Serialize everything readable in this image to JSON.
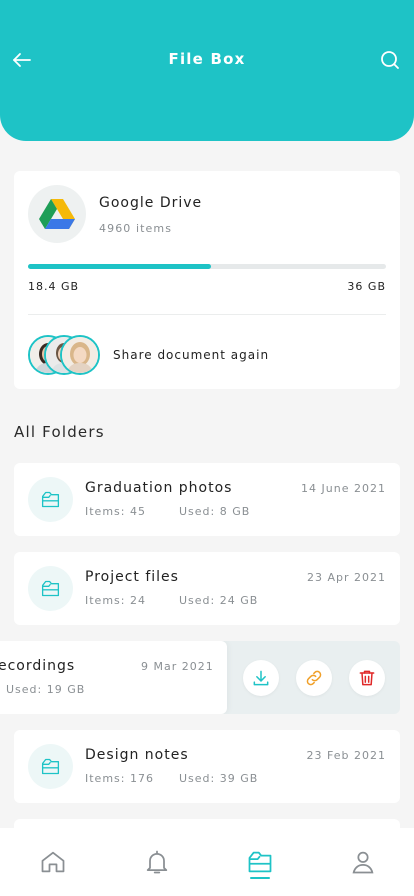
{
  "header": {
    "title": "File Box",
    "background_color": "#1ec3c6",
    "back_icon": "arrow-left-icon",
    "search_icon": "search-icon"
  },
  "storage": {
    "name": "Google Drive",
    "items": "4960 items",
    "used": "18.4 GB",
    "total": "36 GB",
    "used_fraction": 0.511,
    "share_label": "Share document again",
    "accent_color": "#1ec3c6"
  },
  "folders_section": {
    "title": "All Folders",
    "folders": [
      {
        "name": "Graduation photos",
        "date": "14 June 2021",
        "items": "Items: 45",
        "used": "Used: 8 GB"
      },
      {
        "name": "Project files",
        "date": "23 Apr 2021",
        "items": "Items: 24",
        "used": "Used: 24 GB"
      },
      {
        "name": "ecordings",
        "date": "9 Mar 2021",
        "items": "",
        "used": "Used: 19 GB"
      },
      {
        "name": "Design notes",
        "date": "23 Feb 2021",
        "items": "Items: 176",
        "used": "Used: 39 GB"
      }
    ],
    "swipe_actions": [
      "download-icon",
      "link-icon",
      "trash-icon"
    ]
  },
  "tabbar": {
    "tabs": [
      "home-icon",
      "bell-icon",
      "folder-icon",
      "user-icon"
    ],
    "active_tab": "folder-icon"
  }
}
